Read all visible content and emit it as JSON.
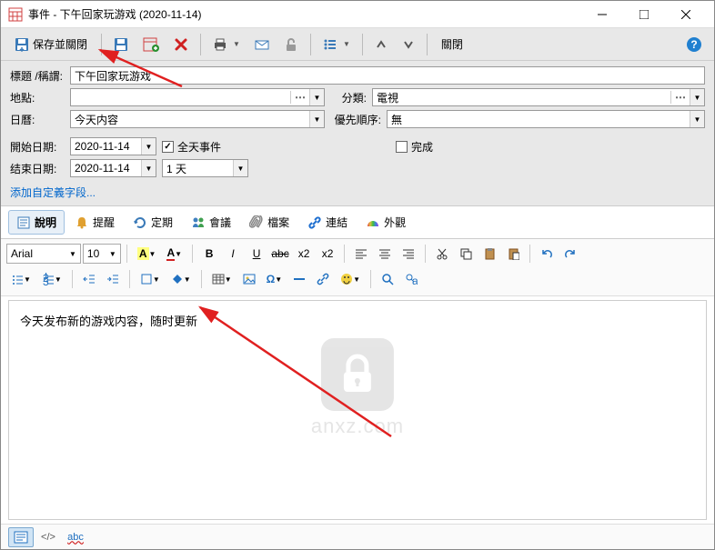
{
  "window": {
    "title": "事件 - 下午回家玩游戏 (2020-11-14)"
  },
  "toolbar": {
    "save_close": "保存並關閉",
    "close": "關閉"
  },
  "form": {
    "title_label": "標題 /稱謂:",
    "title_value": "下午回家玩游戏",
    "location_label": "地點:",
    "location_value": "",
    "category_label": "分類:",
    "category_value": "電視",
    "calendar_label": "日曆:",
    "calendar_value": "今天内容",
    "priority_label": "優先順序:",
    "priority_value": "無",
    "start_date_label": "開始日期:",
    "start_date_value": "2020-11-14",
    "allday_label": "全天事件",
    "completed_label": "完成",
    "end_date_label": "结束日期:",
    "end_date_value": "2020-11-14",
    "duration_value": "1 天",
    "add_field_link": "添加自定義字段..."
  },
  "tabs": {
    "description": "說明",
    "reminder": "提醒",
    "recurrence": "定期",
    "meeting": "會議",
    "files": "檔案",
    "links": "連結",
    "appearance": "外觀"
  },
  "editor": {
    "font_name": "Arial",
    "font_size": "10",
    "content": "今天发布新的游戏内容，随时更新"
  },
  "watermark": {
    "text": "anxz.com"
  }
}
